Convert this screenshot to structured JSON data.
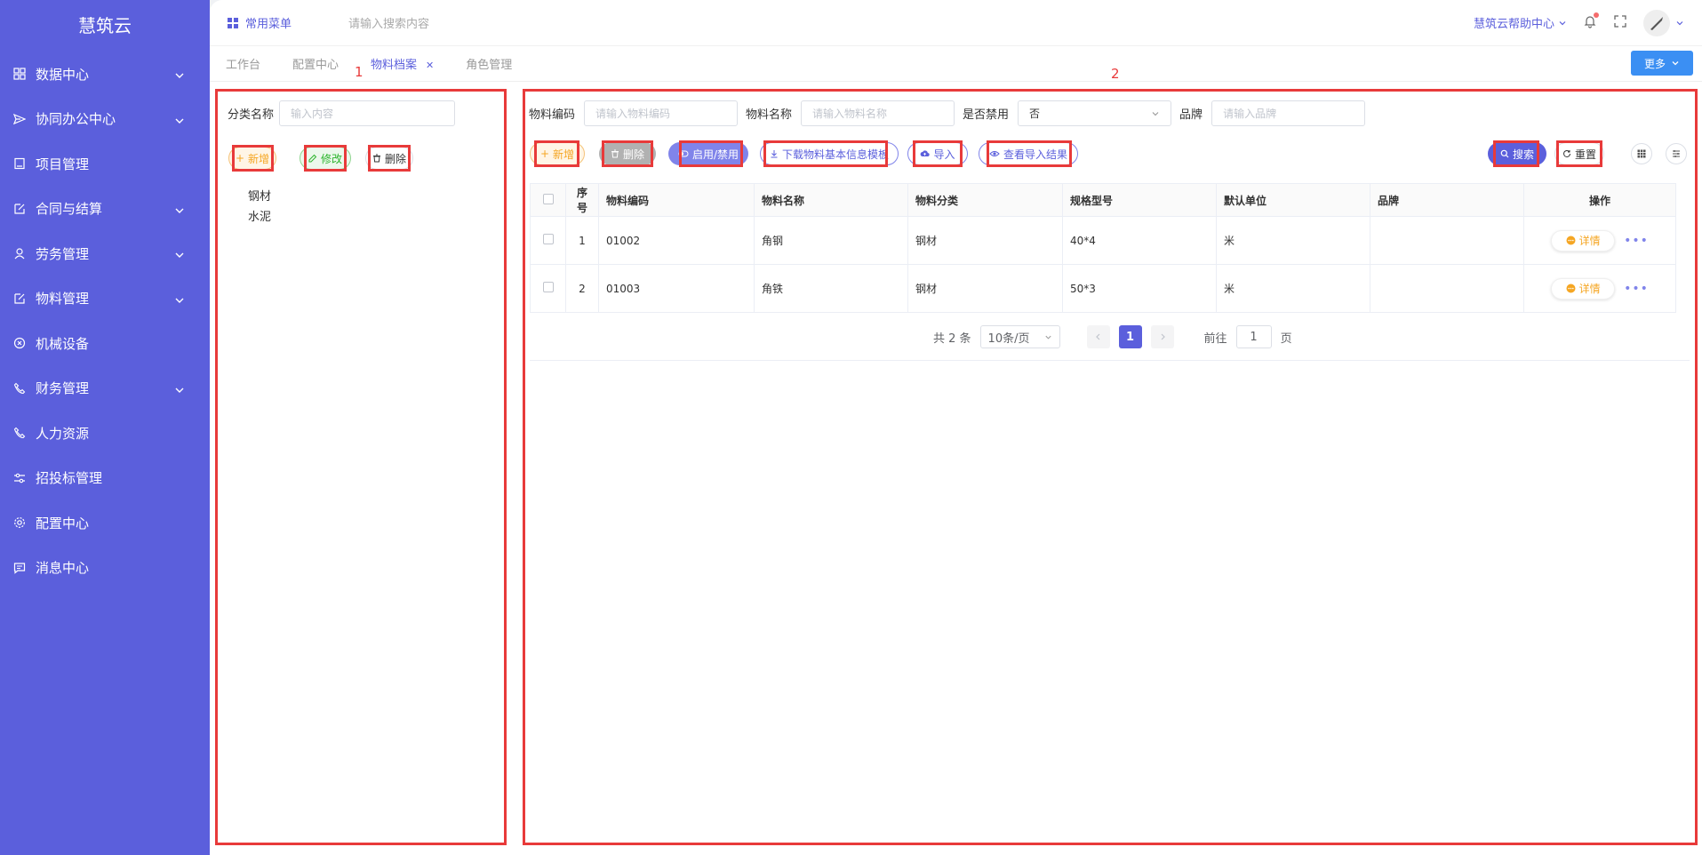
{
  "app": {
    "title": "慧筑云"
  },
  "sidebar": {
    "items": [
      {
        "label": "数据中心",
        "icon": "grid-icon",
        "has_children": true
      },
      {
        "label": "协同办公中心",
        "icon": "send-icon",
        "has_children": true
      },
      {
        "label": "项目管理",
        "icon": "book-icon",
        "has_children": false
      },
      {
        "label": "合同与结算",
        "icon": "edit-doc-icon",
        "has_children": true
      },
      {
        "label": "劳务管理",
        "icon": "worker-icon",
        "has_children": true
      },
      {
        "label": "物料管理",
        "icon": "edit-doc-icon",
        "has_children": true
      },
      {
        "label": "机械设备",
        "icon": "circle-x-icon",
        "has_children": false
      },
      {
        "label": "财务管理",
        "icon": "phone-icon",
        "has_children": true
      },
      {
        "label": "人力资源",
        "icon": "phone-icon",
        "has_children": false
      },
      {
        "label": "招投标管理",
        "icon": "sliders-icon",
        "has_children": false
      },
      {
        "label": "配置中心",
        "icon": "gear-icon",
        "has_children": false
      },
      {
        "label": "消息中心",
        "icon": "chat-icon",
        "has_children": false
      }
    ]
  },
  "topbar": {
    "common_menu": "常用菜单",
    "search_placeholder": "请输入搜索内容",
    "help": "慧筑云帮助中心"
  },
  "tabs": [
    {
      "label": "工作台",
      "active": false,
      "closable": false
    },
    {
      "label": "配置中心",
      "active": false,
      "closable": false
    },
    {
      "label": "物料档案",
      "active": true,
      "closable": true
    },
    {
      "label": "角色管理",
      "active": false,
      "closable": false
    }
  ],
  "more_button": "更多",
  "panel_labels": {
    "left": "1",
    "right": "2"
  },
  "left_panel": {
    "category_label": "分类名称",
    "category_placeholder": "输入内容",
    "add": "新增",
    "edit": "修改",
    "delete": "删除",
    "tree": [
      "钢材",
      "水泥"
    ]
  },
  "filters": {
    "code_label": "物料编码",
    "code_placeholder": "请输入物料编码",
    "name_label": "物料名称",
    "name_placeholder": "请输入物料名称",
    "disabled_label": "是否禁用",
    "disabled_value": "否",
    "brand_label": "品牌",
    "brand_placeholder": "请输入品牌"
  },
  "toolbar": {
    "add": "新增",
    "delete": "删除",
    "toggle": "启用/禁用",
    "download": "下载物料基本信息模板",
    "import": "导入",
    "view_import": "查看导入结果",
    "search": "搜索",
    "reset": "重置"
  },
  "table": {
    "headers": [
      "序号",
      "物料编码",
      "物料名称",
      "物料分类",
      "规格型号",
      "默认单位",
      "品牌",
      "操作"
    ],
    "rows": [
      {
        "index": "1",
        "code": "01002",
        "name": "角钢",
        "category": "钢材",
        "spec": "40*4",
        "unit": "米",
        "brand": "",
        "action": "详情"
      },
      {
        "index": "2",
        "code": "01003",
        "name": "角铁",
        "category": "钢材",
        "spec": "50*3",
        "unit": "米",
        "brand": "",
        "action": "详情"
      }
    ]
  },
  "pagination": {
    "total": "共 2 条",
    "page_size": "10条/页",
    "current_page": "1",
    "goto_label": "前往",
    "goto_value": "1",
    "page_unit": "页"
  },
  "colors": {
    "sidebar": "#5b5fdc",
    "accent": "#5b5fdc",
    "highlight_box": "#e83a3a",
    "warning": "#f5a623",
    "success": "#2db52d"
  }
}
